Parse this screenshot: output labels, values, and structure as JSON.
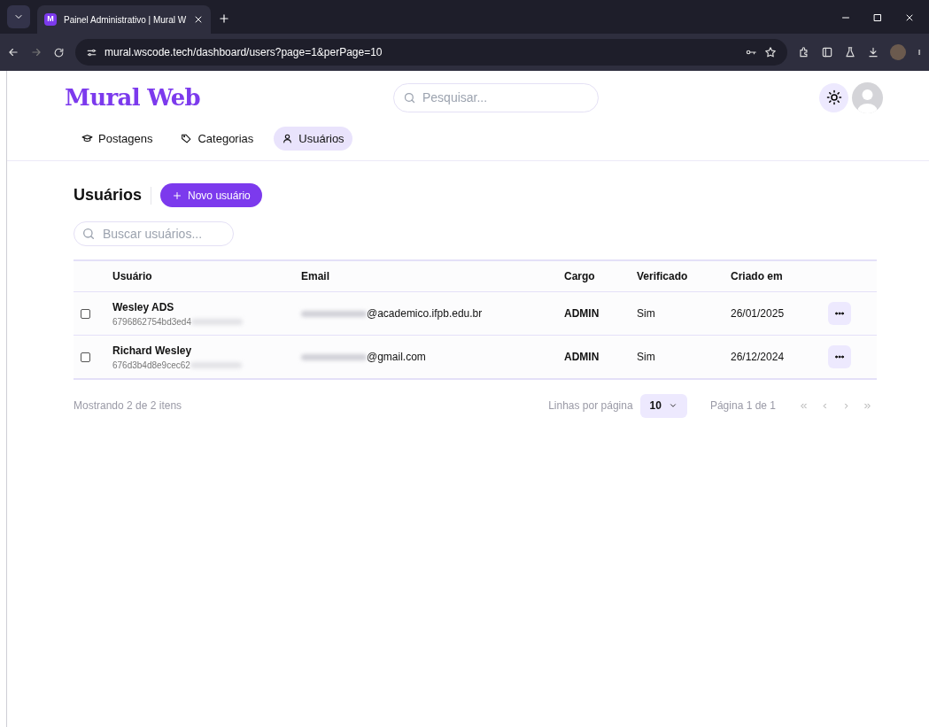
{
  "browser": {
    "tab_title": "Painel Administrativo | Mural W",
    "tab_favicon": "M",
    "url": "mural.wscode.tech/dashboard/users?page=1&perPage=10"
  },
  "header": {
    "logo": "Mural Web",
    "search": {
      "placeholder": "Pesquisar..."
    }
  },
  "nav": [
    {
      "kind": "posts",
      "label": "Postagens",
      "selected": false
    },
    {
      "kind": "categories",
      "label": "Categorias",
      "selected": false
    },
    {
      "kind": "users",
      "label": "Usuários",
      "selected": true
    }
  ],
  "page": {
    "title": "Usuários",
    "new_button": "Novo usuário",
    "search": {
      "placeholder": "Buscar usuários..."
    }
  },
  "table": {
    "columns": [
      "Usuário",
      "Email",
      "Cargo",
      "Verificado",
      "Criado em"
    ],
    "rows": [
      {
        "checked": false,
        "name": "Wesley ADS",
        "id": "6796862754bd3ed4",
        "email": "@academico.ifpb.edu.br",
        "role": "ADMIN",
        "verified": "Sim",
        "created": "26/01/2025"
      },
      {
        "checked": false,
        "name": "Richard Wesley",
        "id": "676d3b4d8e9cec62",
        "email": "@gmail.com",
        "role": "ADMIN",
        "verified": "Sim",
        "created": "26/12/2024"
      }
    ]
  },
  "footer": {
    "summary": "Mostrando 2 de 2 itens",
    "rows_label": "Linhas por página",
    "rows_value": "10",
    "page_label": "Página 1 de 1"
  }
}
